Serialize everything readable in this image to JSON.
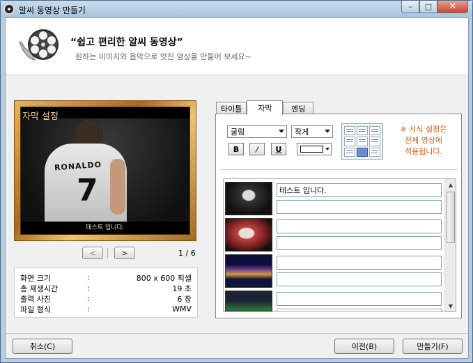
{
  "window": {
    "title": "알씨 동영상 만들기",
    "minimize_glyph": "–",
    "maximize_glyph": "□",
    "close_glyph": "✕"
  },
  "header": {
    "title": "“쉽고 편리한 알씨 동영상”",
    "subtitle": "원하는 이미지와 음악으로 멋진 영상을 만들어 보세요~",
    "icon": "film-reel-icon"
  },
  "preview": {
    "overlay_label": "자막 설정",
    "jersey_name": "RONALDO",
    "jersey_number": "7",
    "caption": "테스트 입니다.",
    "prev_glyph": "<",
    "next_glyph": ">",
    "page_indicator": "1 / 6"
  },
  "info": [
    {
      "label": "화면 크기",
      "colon": ":",
      "value": "800 x 600 픽셀"
    },
    {
      "label": "총 재생시간",
      "colon": ":",
      "value": "19 초"
    },
    {
      "label": "출력 사진",
      "colon": ":",
      "value": "6 장"
    },
    {
      "label": "파일 형식",
      "colon": ":",
      "value": "WMV"
    }
  ],
  "tabs": [
    {
      "label": "타이틀",
      "active": false
    },
    {
      "label": "자막",
      "active": true
    },
    {
      "label": "엔딩",
      "active": false
    }
  ],
  "format": {
    "font": "굴림",
    "size": "작게",
    "bold": "B",
    "italic": "/",
    "underline": "U",
    "text_color": "#ffffff",
    "selected_alignment": "bottom-center"
  },
  "notice": "※ 서식 설정은\n전체 영상에\n적용됩니다.",
  "caption_rows": [
    {
      "line1": "테스트 입니다.",
      "line2": ""
    },
    {
      "line1": "",
      "line2": ""
    },
    {
      "line1": "",
      "line2": ""
    },
    {
      "line1": "",
      "line2": ""
    }
  ],
  "scrollbar": {
    "up_glyph": "▲",
    "down_glyph": "▼"
  },
  "buttons": {
    "cancel": "취소(C)",
    "prev": "이전(B)",
    "make": "만들기(F)"
  }
}
